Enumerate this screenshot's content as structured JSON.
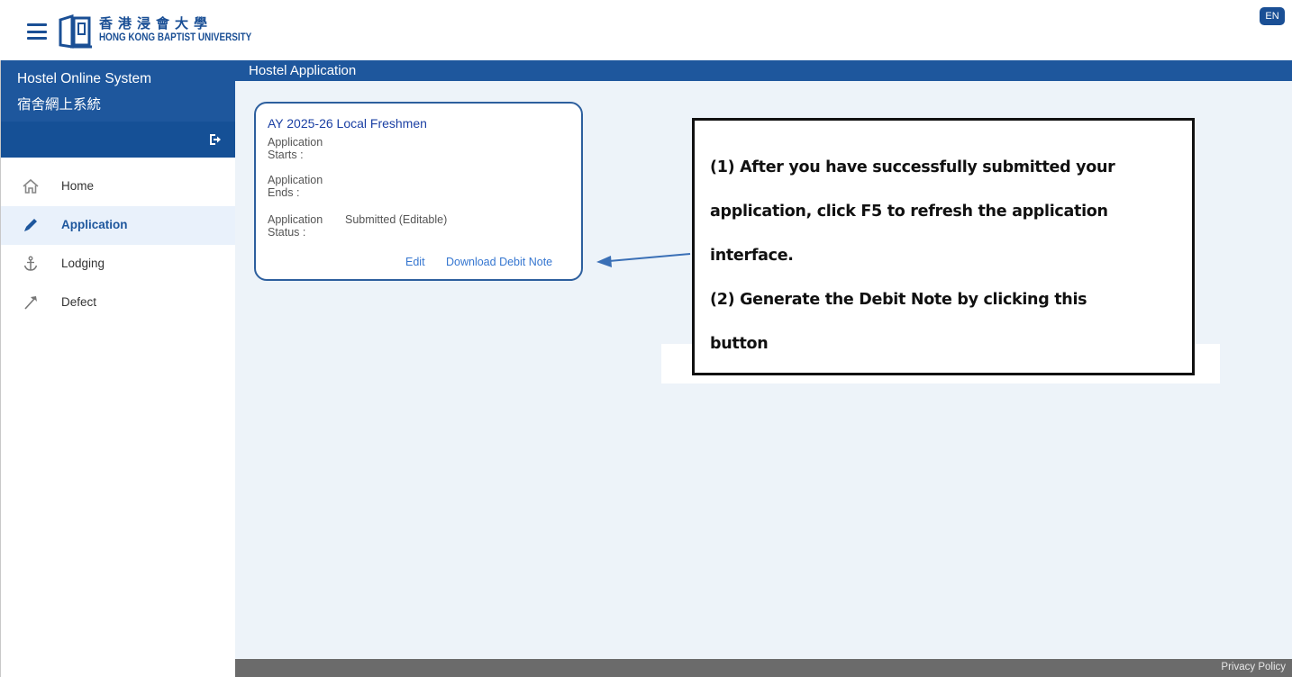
{
  "header": {
    "logo_zh": "香港浸會大學",
    "logo_en": "HONG KONG BAPTIST UNIVERSITY",
    "lang_button": "EN"
  },
  "page": {
    "heading": "Hostel Application"
  },
  "sidebar": {
    "title_en": "Hostel Online System",
    "title_zh": "宿舍網上系統",
    "items": [
      {
        "label": "Home",
        "icon": "home-icon",
        "active": false
      },
      {
        "label": "Application",
        "icon": "pencil-icon",
        "active": true
      },
      {
        "label": "Lodging",
        "icon": "anchor-icon",
        "active": false
      },
      {
        "label": "Defect",
        "icon": "hammer-icon",
        "active": false
      }
    ]
  },
  "card": {
    "title": "AY 2025-26 Local Freshmen",
    "starts_label_1": "Application",
    "starts_label_2": "Starts :",
    "ends_label_1": "Application",
    "ends_label_2": "Ends :",
    "status_label_1": "Application",
    "status_label_2": "Status :",
    "status_value": "Submitted (Editable)",
    "edit_link": "Edit",
    "download_link": "Download Debit Note"
  },
  "annotation": {
    "line1": "(1) After you have successfully submitted your",
    "line2": "application, click F5 to refresh the application",
    "line3": "interface.",
    "line4": "(2) Generate the Debit Note by clicking this",
    "line5": "button"
  },
  "footer": {
    "privacy": "Privacy Policy"
  },
  "colors": {
    "brand_blue": "#1e579d",
    "link_blue": "#3576d0",
    "content_bg": "#edf3f9",
    "footer_gray": "#6b6b6b"
  }
}
